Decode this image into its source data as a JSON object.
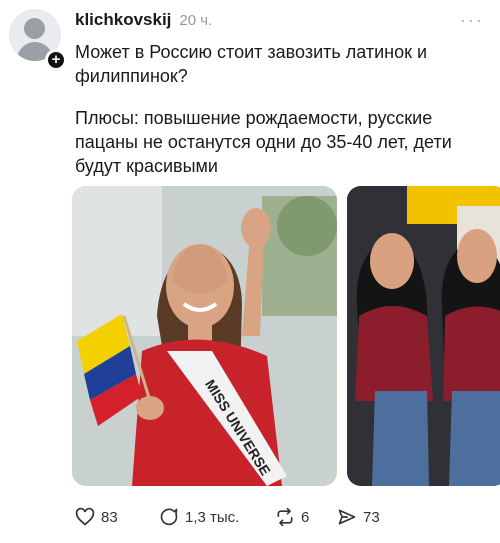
{
  "post": {
    "username": "klichkovskij",
    "timestamp": "20 ч.",
    "more_label": "···",
    "paragraphs": [
      "Может в Россию стоит завозить латинок и филиппинок?",
      "Плюсы: повышение рождаемости, русские пацаны не останутся одни до 35-40 лет, дети будут красивыми"
    ],
    "images": [
      {
        "caption_text": "MISS UNIVERSE"
      },
      {
        "caption_text": ""
      }
    ],
    "actions": {
      "likes": "83",
      "replies": "1,3 тыс.",
      "reposts": "6",
      "shares": "73"
    }
  },
  "colors": {
    "text": "#1a1a1a",
    "muted": "#9a9a9a",
    "icon": "#333333"
  },
  "icons": [
    "plus-icon",
    "more-icon",
    "heart-icon",
    "comment-icon",
    "repost-icon",
    "share-icon"
  ]
}
